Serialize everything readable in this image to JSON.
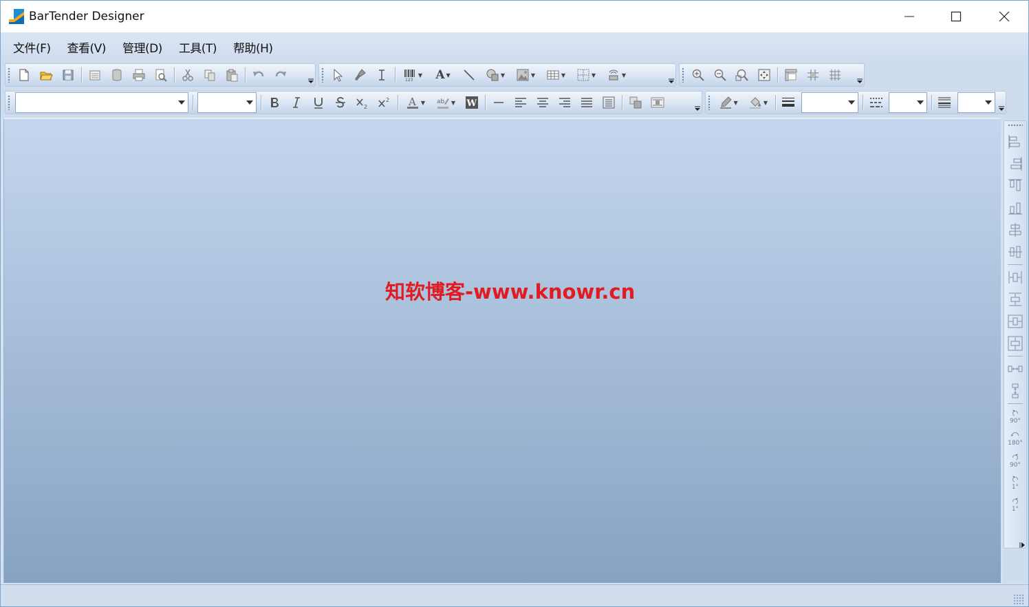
{
  "window": {
    "title": "BarTender Designer"
  },
  "menu": [
    "文件(F)",
    "查看(V)",
    "管理(D)",
    "工具(T)",
    "帮助(H)"
  ],
  "toolbar_row2": {
    "font_name_value": "",
    "font_size_value": ""
  },
  "watermark": "知软博客-www.knowr.cn",
  "rotate_labels": {
    "ccw90": "90°",
    "r180": "180°",
    "cw90": "90°",
    "ccw1": "1°",
    "cw1": "1°"
  },
  "colors": {
    "accent": "#e01b22",
    "canvas_top": "#c4d7ee",
    "canvas_bottom": "#86a2c3",
    "menubar": "#d4e1f1"
  },
  "icons": {
    "standard_toolbar": [
      "new-icon",
      "open-icon",
      "save-icon",
      "page-setup-icon",
      "database-icon",
      "print-icon",
      "print-preview-icon",
      "cut-icon",
      "copy-icon",
      "paste-icon",
      "undo-icon",
      "redo-icon"
    ],
    "object_toolbar": [
      "select-icon",
      "format-painter-icon",
      "text-cursor-icon",
      "barcode-icon",
      "text-tool-icon",
      "line-tool-icon",
      "shapes-icon",
      "picture-icon",
      "table-icon",
      "grid-icon",
      "rfid-icon"
    ],
    "zoom_toolbar": [
      "zoom-in-icon",
      "zoom-out-icon",
      "zoom-window-icon",
      "fit-page-icon",
      "ruler-icon",
      "snap-icon",
      "show-grid-icon"
    ],
    "format_toolbar": [
      "bold-icon",
      "italic-icon",
      "underline-icon",
      "strikethrough-icon",
      "subscript-icon",
      "superscript-icon",
      "font-color-icon",
      "highlight-icon",
      "word-icon",
      "line-icon",
      "align-left-icon",
      "align-center-icon",
      "align-right-icon",
      "justify-icon",
      "text-fit-icon",
      "bring-front-icon",
      "wrap-text-icon"
    ],
    "line_toolbar": [
      "pen-color-icon",
      "fill-color-icon",
      "line-weight-icon",
      "line-style-icon",
      "border-style-icon"
    ],
    "align_toolbar": [
      "align-left-edges-icon",
      "align-right-edges-icon",
      "align-top-edges-icon",
      "align-bottom-edges-icon",
      "align-centers-icon",
      "align-middles-icon",
      "center-horizontal-icon",
      "center-vertical-icon",
      "center-page-h-icon",
      "center-page-v-icon",
      "distribute-horizontal-icon",
      "distribute-vertical-icon",
      "rotate-ccw-90-icon",
      "rotate-180-icon",
      "rotate-cw-90-icon",
      "rotate-ccw-1-icon",
      "rotate-cw-1-icon"
    ]
  }
}
